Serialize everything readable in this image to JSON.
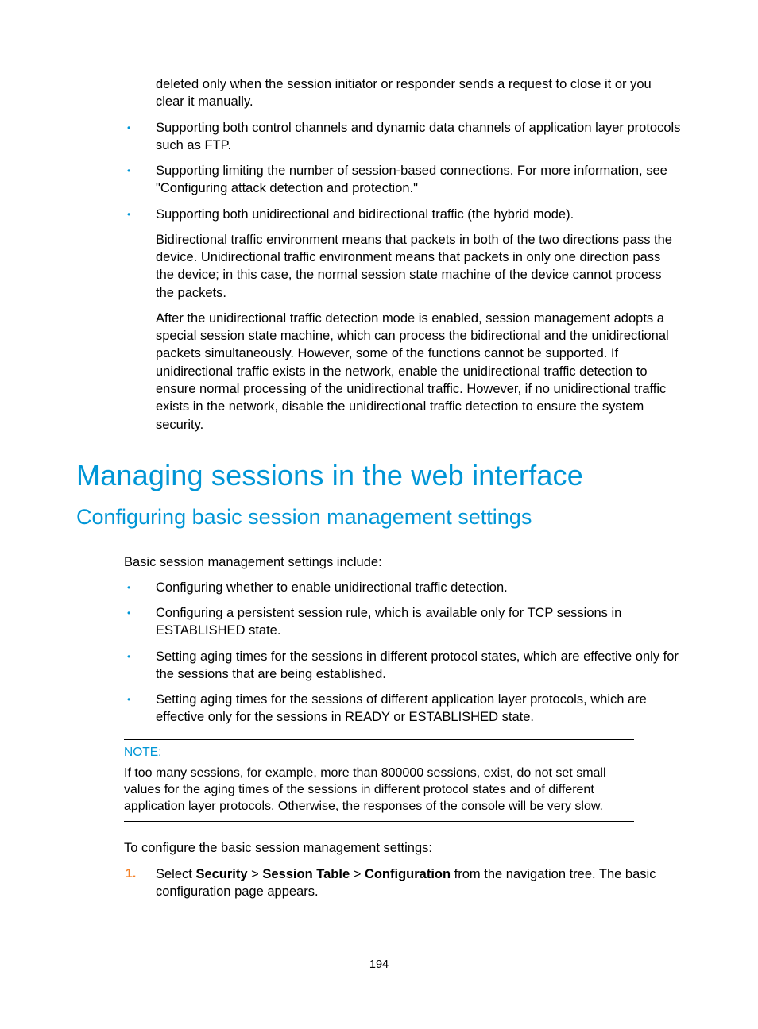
{
  "topBullets": {
    "continuation": "deleted only when the session initiator or responder sends a request to close it or you clear it manually.",
    "items": [
      {
        "text": "Supporting both control channels and dynamic data channels of application layer protocols such as FTP."
      },
      {
        "text": "Supporting limiting the number of session-based connections. For more information, see \"Configuring attack detection and protection.\""
      },
      {
        "text": "Supporting both unidirectional and bidirectional traffic (the hybrid mode).",
        "follow1": "Bidirectional traffic environment means that packets in both of the two directions pass the device. Unidirectional traffic environment means that packets in only one direction pass the device; in this case, the normal session state machine of the device cannot process the packets.",
        "follow2": "After the unidirectional traffic detection mode is enabled, session management adopts a special session state machine, which can process the bidirectional and the unidirectional packets simultaneously. However, some of the functions cannot be supported. If unidirectional traffic exists in the network, enable the unidirectional traffic detection to ensure normal processing of the unidirectional traffic. However, if no unidirectional traffic exists in the network, disable the unidirectional traffic detection to ensure the system security."
      }
    ]
  },
  "h1": "Managing sessions in the web interface",
  "h2": "Configuring basic session management settings",
  "intro": "Basic session management settings include:",
  "settingsBullets": [
    "Configuring whether to enable unidirectional traffic detection.",
    "Configuring a persistent session rule, which is available only for TCP sessions in ESTABLISHED state.",
    "Setting aging times for the sessions in different protocol states, which are effective only for the sessions that are being established.",
    "Setting aging times for the sessions of different application layer protocols, which are effective only for the sessions in READY or ESTABLISHED state."
  ],
  "note": {
    "label": "NOTE:",
    "body": "If too many sessions, for example, more than 800000 sessions, exist, do not set small values for the aging times of the sessions in different protocol states and of different application layer protocols. Otherwise, the responses of the console will be very slow."
  },
  "stepsIntro": "To configure the basic session management settings:",
  "steps": [
    {
      "pre": "Select ",
      "b1": "Security",
      "sep1": " > ",
      "b2": "Session Table",
      "sep2": " > ",
      "b3": "Configuration",
      "post": " from the navigation tree.",
      "follow": "The basic configuration page appears."
    }
  ],
  "pageNumber": "194"
}
